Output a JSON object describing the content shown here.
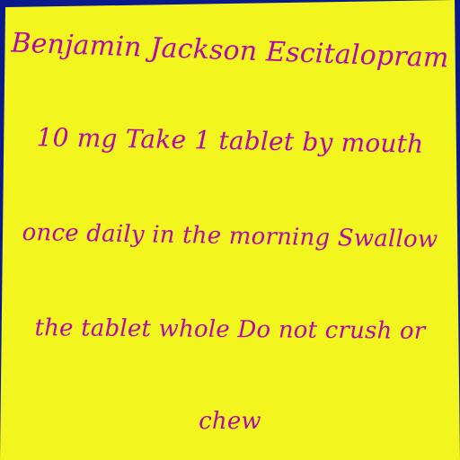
{
  "note": {
    "lines": [
      "Benjamin Jackson Escitalopram",
      "10 mg Take 1 tablet by mouth",
      "once daily in the morning Swallow",
      "the tablet whole Do not crush or",
      "chew"
    ],
    "colors": {
      "background": "#0b1a8a",
      "paper": "#f2f51e",
      "ink": "#b10aa8"
    }
  }
}
